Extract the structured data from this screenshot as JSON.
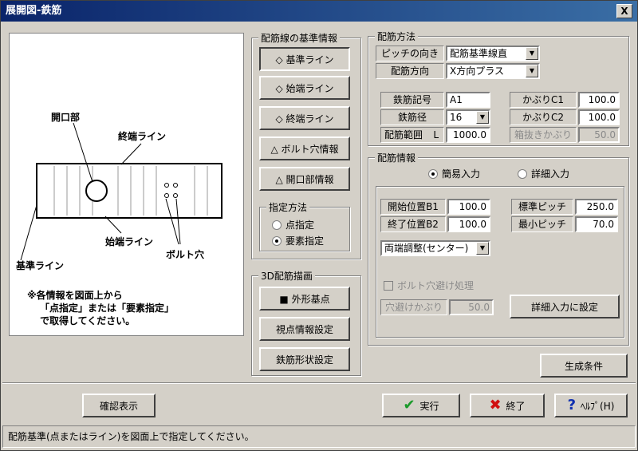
{
  "window": {
    "title": "展開図-鉄筋",
    "close_label": "X"
  },
  "drawing": {
    "labels": {
      "opening": "開口部",
      "end_line": "終端ライン",
      "start_line": "始端ライン",
      "base_line": "基準ライン",
      "bolt_hole": "ボルト穴"
    },
    "note_lines": [
      "※各情報を図面上から",
      "「点指定」または「要素指定」",
      "で取得してください。"
    ]
  },
  "base_info": {
    "title": "配筋線の基準情報",
    "buttons": [
      "◇ 基準ライン",
      "◇ 始端ライン",
      "◇ 終端ライン",
      "△ ボルト穴情報",
      "△ 開口部情報"
    ],
    "spec_method": {
      "title": "指定方法",
      "options": [
        "点指定",
        "要素指定"
      ],
      "selected": 1
    }
  },
  "draw3d": {
    "title": "3D配筋描画",
    "buttons": [
      "■ 外形基点",
      "視点情報設定",
      "鉄筋形状設定"
    ]
  },
  "method": {
    "title": "配筋方法",
    "pitch_dir_label": "ピッチの向き",
    "pitch_dir_value": "配筋基準線直",
    "arr_dir_label": "配筋方向",
    "arr_dir_value": "X方向プラス",
    "symbol_label": "鉄筋記号",
    "symbol_value": "A1",
    "diameter_label": "鉄筋径",
    "diameter_value": "16",
    "range_label": "配筋範囲",
    "range_unit": "L",
    "range_value": "1000.0",
    "cover1_label": "かぶりC1",
    "cover1_value": "100.0",
    "cover2_label": "かぶりC2",
    "cover2_value": "100.0",
    "box_cover_label": "箱抜きかぶり",
    "box_cover_value": "50.0"
  },
  "info": {
    "title": "配筋情報",
    "simple_label": "簡易入力",
    "detail_label": "詳細入力",
    "mode_selected": 0,
    "start_label": "開始位置B1",
    "start_value": "100.0",
    "end_label": "終了位置B2",
    "end_value": "100.0",
    "std_pitch_label": "標準ピッチ",
    "std_pitch_value": "250.0",
    "min_pitch_label": "最小ピッチ",
    "min_pitch_value": "70.0",
    "adjust_value": "両端調整(センター)",
    "bolt_avoid_label": "ボルト穴避け処理",
    "hole_cover_label": "穴避けかぶり",
    "hole_cover_value": "50.0",
    "set_detail_label": "詳細入力に設定"
  },
  "buttons": {
    "generate": "生成条件",
    "confirm": "確認表示",
    "run": "実行",
    "exit": "終了",
    "help": "ﾍﾙﾌﾟ(H)"
  },
  "status": "配筋基準(点またはライン)を図面上で指定してください。",
  "colors": {
    "title_bar": "#0a246a",
    "run_check": "#1a9a2a",
    "exit_x": "#d01010",
    "help_q": "#1030b0"
  }
}
